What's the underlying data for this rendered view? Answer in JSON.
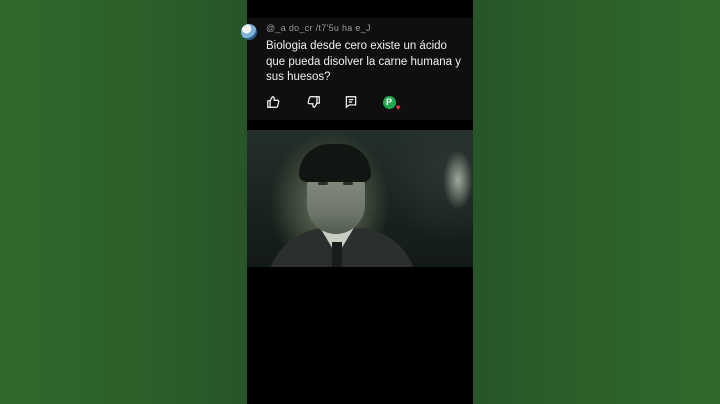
{
  "comment": {
    "handle": "@_a  do_cr  /t7'5u  ha  e_J",
    "text": "Biologia desde cero existe un ácido que pueda disolver la carne humana y sus huesos?",
    "creator_heart_badge": "P",
    "actions": [
      "like-icon",
      "dislike-icon",
      "reply-icon",
      "creator-heart-icon"
    ]
  },
  "colors": {
    "background_green": "#2e5f2c",
    "comment_bg": "#0f0f0f",
    "heart_badge": "#1ea84f",
    "heart": "#ff2b4a"
  }
}
